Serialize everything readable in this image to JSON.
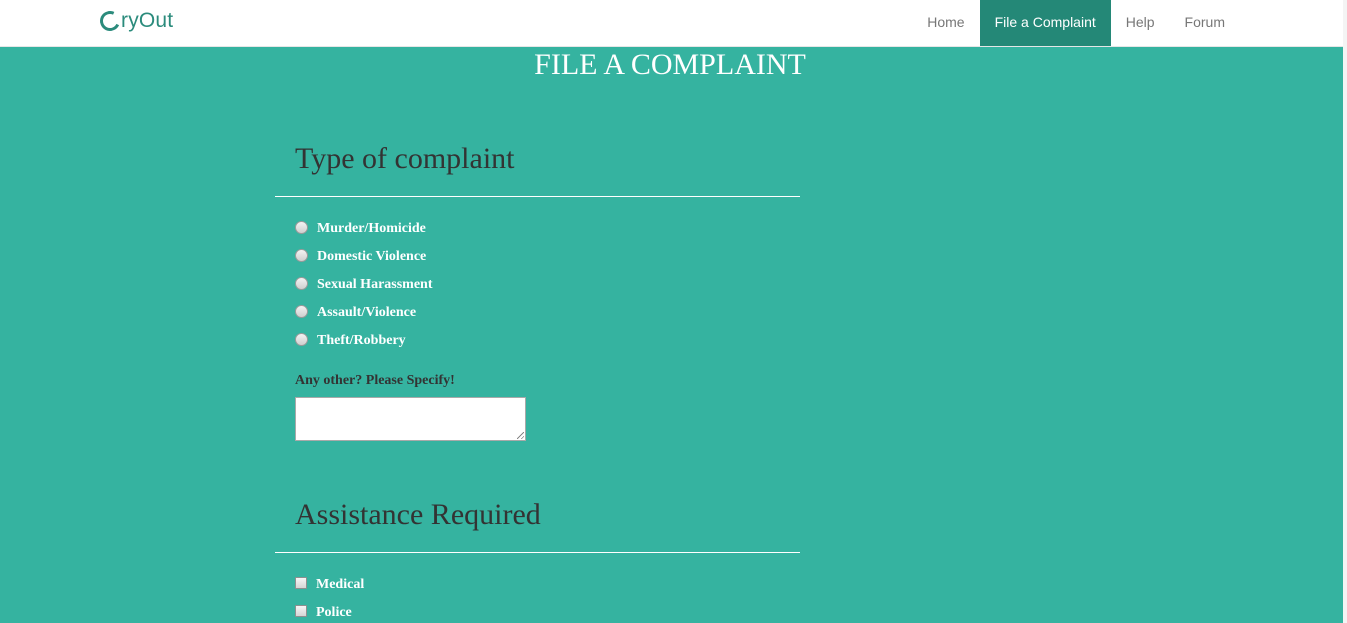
{
  "navbar": {
    "brand": "ryOut",
    "items": [
      {
        "label": "Home",
        "active": false
      },
      {
        "label": "File a Complaint",
        "active": true
      },
      {
        "label": "Help",
        "active": false
      },
      {
        "label": "Forum",
        "active": false
      }
    ]
  },
  "page_title": "FILE A COMPLAINT",
  "complaint_type": {
    "heading": "Type of complaint",
    "options": [
      {
        "label": "Murder/Homicide",
        "checked": false
      },
      {
        "label": "Domestic Violence",
        "checked": false
      },
      {
        "label": "Sexual Harassment",
        "checked": false
      },
      {
        "label": "Assault/Violence",
        "checked": false
      },
      {
        "label": "Theft/Robbery",
        "checked": false
      }
    ],
    "other_label": "Any other? Please Specify!",
    "other_value": ""
  },
  "assistance": {
    "heading": "Assistance Required",
    "options": [
      {
        "label": "Medical",
        "checked": false
      },
      {
        "label": "Police",
        "checked": false
      }
    ]
  },
  "colors": {
    "page_background": "#35b3a0",
    "active_nav": "#248877",
    "brand": "#2b8b7c"
  }
}
